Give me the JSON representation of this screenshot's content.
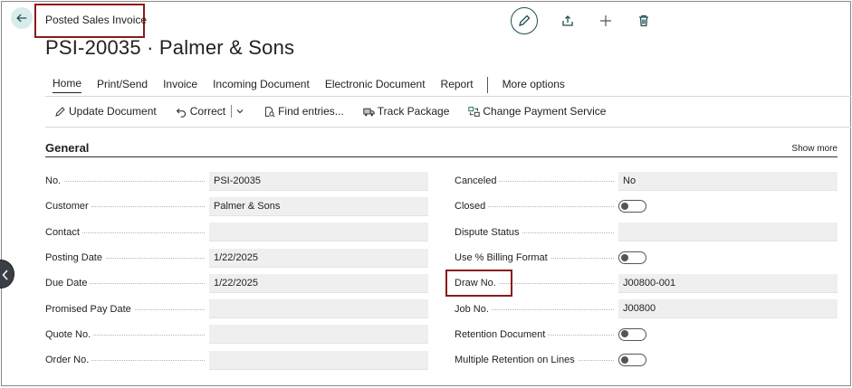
{
  "page": {
    "caption": "Posted Sales Invoice",
    "title": "PSI-20035 · Palmer & Sons"
  },
  "tabs": [
    "Home",
    "Print/Send",
    "Invoice",
    "Incoming Document",
    "Electronic Document",
    "Report"
  ],
  "more_options": "More options",
  "actions": {
    "update_document": "Update Document",
    "correct": "Correct",
    "find_entries": "Find entries...",
    "track_package": "Track Package",
    "change_payment_service": "Change Payment Service"
  },
  "section": {
    "title": "General",
    "show_more": "Show more"
  },
  "left_fields": [
    {
      "label": "No.",
      "value": "PSI-20035"
    },
    {
      "label": "Customer",
      "value": "Palmer & Sons"
    },
    {
      "label": "Contact",
      "value": ""
    },
    {
      "label": "Posting Date",
      "value": "1/22/2025"
    },
    {
      "label": "Due Date",
      "value": "1/22/2025"
    },
    {
      "label": "Promised Pay Date",
      "value": ""
    },
    {
      "label": "Quote No.",
      "value": ""
    },
    {
      "label": "Order No.",
      "value": ""
    }
  ],
  "right_fields": [
    {
      "label": "Canceled",
      "value": "No"
    },
    {
      "label": "Closed",
      "value": ""
    },
    {
      "label": "Dispute Status",
      "value": ""
    },
    {
      "label": "Use % Billing Format",
      "value": ""
    },
    {
      "label": "Draw No.",
      "value": "J00800-001"
    },
    {
      "label": "Job No.",
      "value": "J00800"
    },
    {
      "label": "Retention Document",
      "value": ""
    },
    {
      "label": "Multiple Retention on Lines",
      "value": ""
    }
  ],
  "icons": {
    "back": "arrow-left-icon",
    "edit": "pencil-icon",
    "share": "share-icon",
    "new": "plus-icon",
    "delete": "trash-icon"
  },
  "colors": {
    "accent": "#1f4e4e",
    "highlight_border": "#8b1a1a",
    "field_bg": "#efefef"
  }
}
